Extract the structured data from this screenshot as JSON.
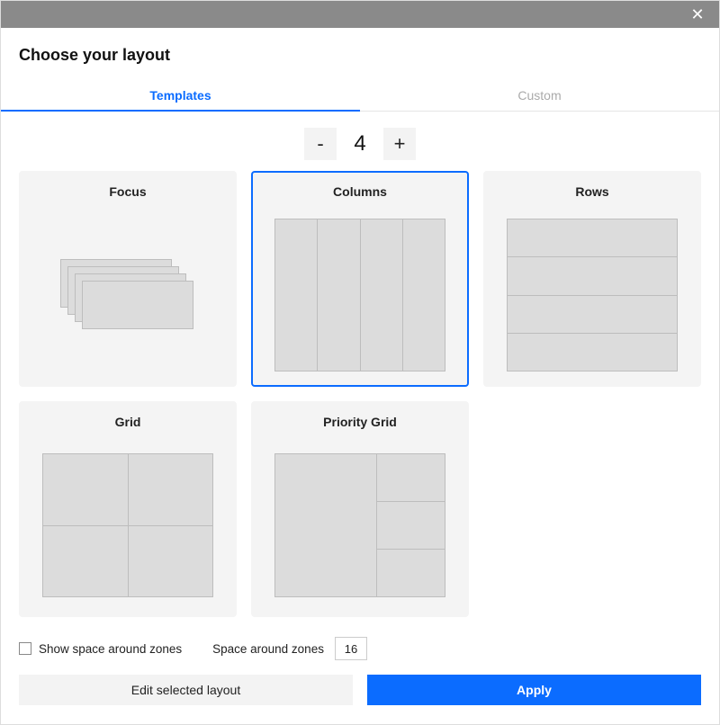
{
  "title": "Choose your layout",
  "tabs": {
    "templates": "Templates",
    "custom": "Custom"
  },
  "stepper": {
    "minus": "-",
    "value": "4",
    "plus": "+"
  },
  "templates": {
    "focus": "Focus",
    "columns": "Columns",
    "rows": "Rows",
    "grid": "Grid",
    "priority_grid": "Priority Grid"
  },
  "options": {
    "show_space_label": "Show space around zones",
    "space_label": "Space around zones",
    "space_value": "16"
  },
  "buttons": {
    "edit": "Edit selected layout",
    "apply": "Apply"
  }
}
